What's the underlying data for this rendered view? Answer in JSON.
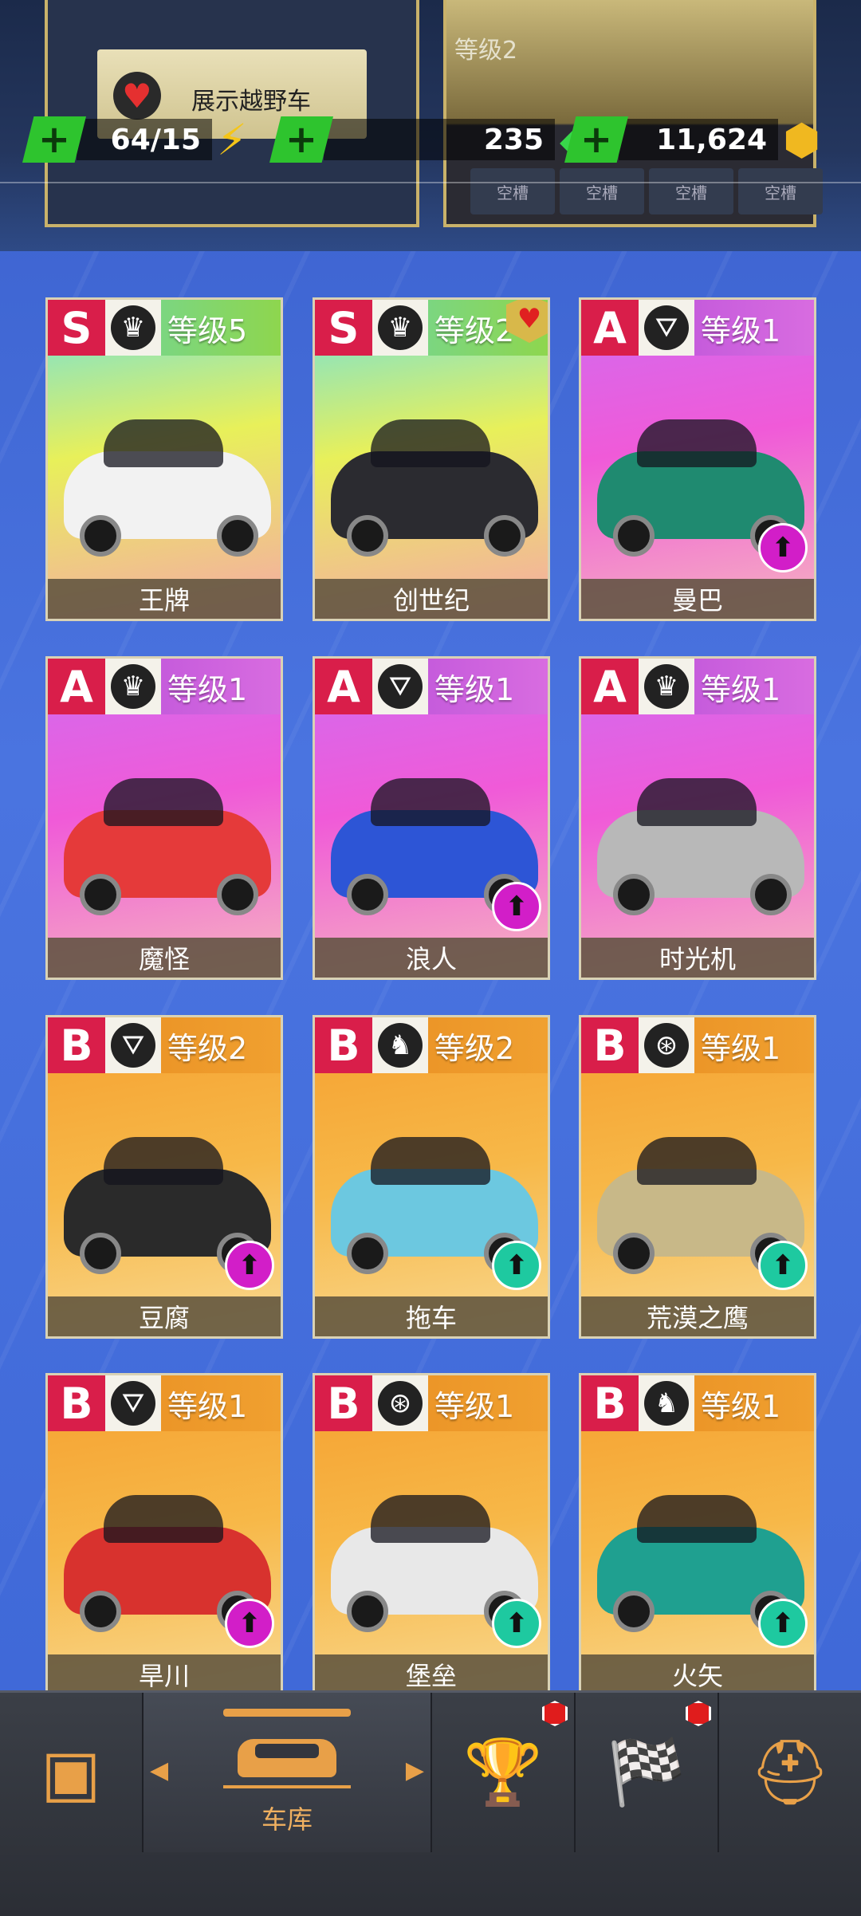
{
  "top": {
    "showcase_label": "展示越野车",
    "right_card_level": "等级2",
    "empty_slots": [
      "空槽",
      "空槽",
      "空槽",
      "空槽"
    ]
  },
  "resources": [
    {
      "value": "64/15",
      "icon": "lightning-icon"
    },
    {
      "value": "235",
      "icon": "green-gem-icon"
    },
    {
      "value": "11,624",
      "icon": "gold-coin-icon"
    }
  ],
  "cars": [
    {
      "grade": "S",
      "level": "等级5",
      "name": "王牌",
      "class_icon": "crown-icon",
      "tier": "s"
    },
    {
      "grade": "S",
      "level": "等级2",
      "name": "创世纪",
      "class_icon": "crown-icon",
      "tier": "s",
      "favorite": true
    },
    {
      "grade": "A",
      "level": "等级1",
      "name": "曼巴",
      "class_icon": "road-icon",
      "tier": "a",
      "upgrade": "magenta"
    },
    {
      "grade": "A",
      "level": "等级1",
      "name": "魔怪",
      "class_icon": "crown-icon",
      "tier": "a"
    },
    {
      "grade": "A",
      "level": "等级1",
      "name": "浪人",
      "class_icon": "road-icon",
      "tier": "a",
      "upgrade": "magenta"
    },
    {
      "grade": "A",
      "level": "等级1",
      "name": "时光机",
      "class_icon": "crown-icon",
      "tier": "a"
    },
    {
      "grade": "B",
      "level": "等级2",
      "name": "豆腐",
      "class_icon": "road-icon",
      "tier": "b",
      "upgrade": "magenta"
    },
    {
      "grade": "B",
      "level": "等级2",
      "name": "拖车",
      "class_icon": "horse-icon",
      "tier": "b",
      "upgrade": "teal"
    },
    {
      "grade": "B",
      "level": "等级1",
      "name": "荒漠之鹰",
      "class_icon": "tire-icon",
      "tier": "b",
      "upgrade": "teal"
    },
    {
      "grade": "B",
      "level": "等级1",
      "name": "旱川",
      "class_icon": "road-icon",
      "tier": "b",
      "upgrade": "magenta"
    },
    {
      "grade": "B",
      "level": "等级1",
      "name": "堡垒",
      "class_icon": "tire-icon",
      "tier": "b",
      "upgrade": "teal"
    },
    {
      "grade": "B",
      "level": "等级1",
      "name": "火矢",
      "class_icon": "horse-icon",
      "tier": "b",
      "upgrade": "teal"
    }
  ],
  "nav": {
    "garage_label": "车库"
  },
  "colors": {
    "grade_red": "#d91e4a",
    "accent_orange": "#e8a048",
    "plus_green": "#2ec42e"
  }
}
